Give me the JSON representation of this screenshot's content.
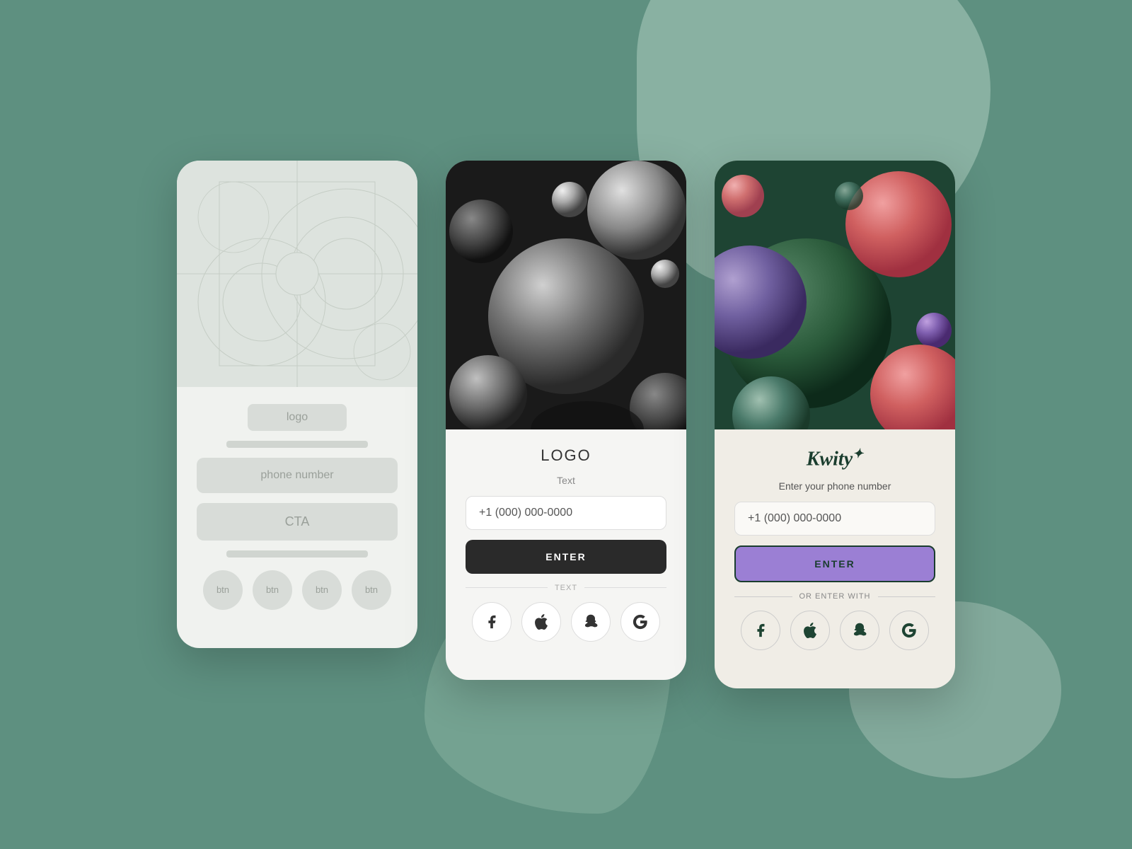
{
  "background": {
    "color": "#5e9080"
  },
  "card1": {
    "type": "wireframe",
    "logo_label": "logo",
    "phone_label": "phone number",
    "cta_label": "CTA",
    "btn_labels": [
      "btn",
      "btn",
      "btn",
      "btn"
    ]
  },
  "card2": {
    "type": "dark",
    "logo": "LOGO",
    "text_label": "Text",
    "phone_placeholder": "+1 (000) 000-0000",
    "enter_label": "ENTER",
    "divider_text": "TEXT",
    "social_icons": [
      "facebook",
      "apple",
      "snapchat",
      "google"
    ]
  },
  "card3": {
    "type": "colored",
    "logo": "Kwity",
    "logo_sup": "✦",
    "subtitle": "Enter your phone number",
    "phone_placeholder": "+1 (000) 000-0000",
    "enter_label": "ENTER",
    "divider_text": "OR ENTER WITH",
    "social_icons": [
      "facebook",
      "apple",
      "snapchat",
      "google"
    ]
  }
}
